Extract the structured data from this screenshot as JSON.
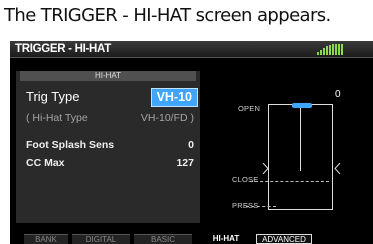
{
  "caption": "The TRIGGER - HI-HAT screen appears.",
  "screen": {
    "title": "TRIGGER - HI-HAT",
    "section_header": "HI-HAT",
    "params": {
      "trig_type": {
        "label": "Trig Type",
        "value": "VH-10"
      },
      "hihat_type": {
        "label": "( Hi-Hat Type",
        "value": "VH-10/FD )"
      },
      "foot_splash": {
        "label": "Foot Splash Sens",
        "value": "0"
      },
      "cc_max": {
        "label": "CC Max",
        "value": "127"
      }
    },
    "pedal": {
      "value": "0",
      "open_label": "OPEN",
      "close_label": "CLOSE",
      "press_label": "PRESS"
    },
    "tabs": [
      {
        "label": "BANK"
      },
      {
        "label": "DIGITAL"
      },
      {
        "label": "BASIC"
      },
      {
        "label": "HI-HAT"
      },
      {
        "label": "ADVANCED"
      }
    ],
    "colors": {
      "highlight": "#3fa5ff",
      "meter": "#8cd94a"
    }
  }
}
